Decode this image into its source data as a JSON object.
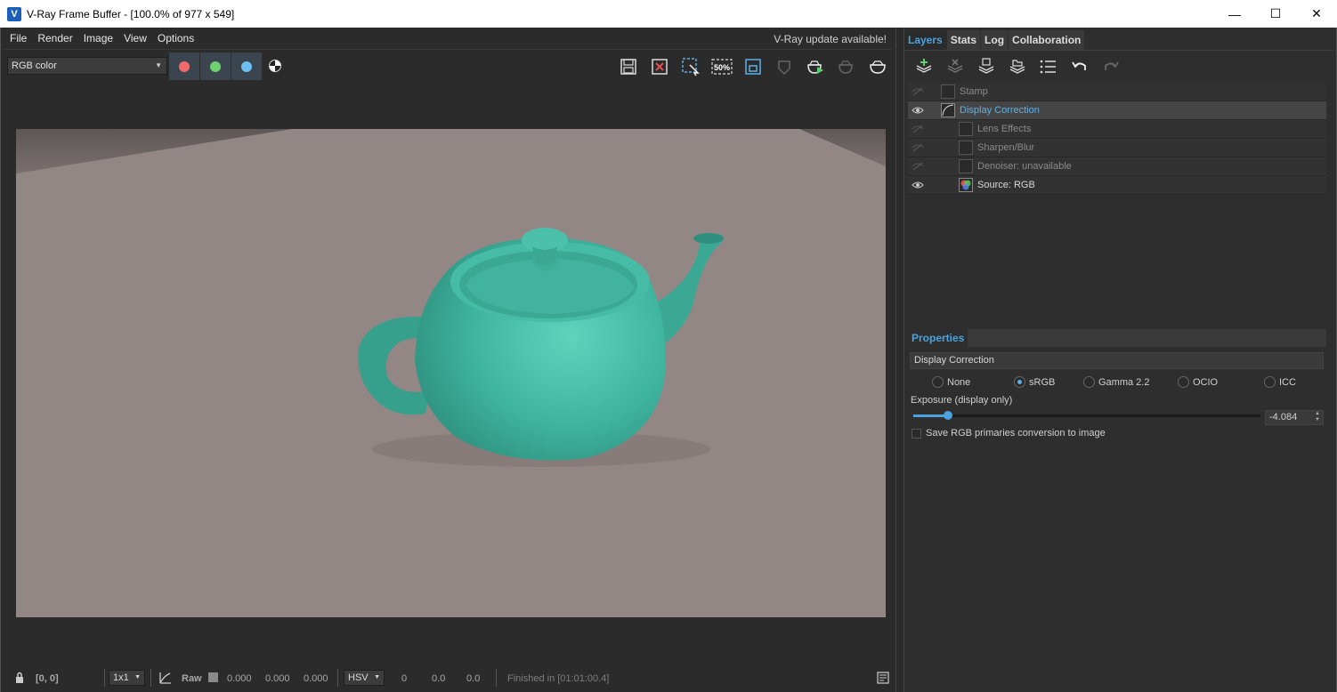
{
  "window": {
    "title": "V-Ray Frame Buffer - [100.0% of 977 x 549]",
    "app_icon_glyph": "V",
    "minimize_glyph": "—",
    "maximize_glyph": "☐",
    "close_glyph": "✕"
  },
  "menu": {
    "items": [
      "File",
      "Render",
      "Image",
      "View",
      "Options"
    ],
    "update_notice": "V-Ray update available!"
  },
  "toolbar": {
    "channel": "RGB color",
    "channel_buttons": [
      {
        "name": "red-channel",
        "color": "#ef6b6b"
      },
      {
        "name": "green-channel",
        "color": "#6ed06e"
      },
      {
        "name": "blue-channel",
        "color": "#6bc0ef"
      }
    ],
    "tool_icons": [
      "save-icon",
      "clear-image-icon",
      "region-render-icon",
      "track-mouse-icon",
      "render-region-icon",
      "lock-icon",
      "interactive-render-icon",
      "stop-render-icon",
      "render-icon"
    ],
    "track_label": "50%"
  },
  "status": {
    "coords": "[0, 0]",
    "sampling": "1x1",
    "raw_label": "Raw",
    "raw_values": [
      "0.000",
      "0.000",
      "0.000"
    ],
    "color_mode": "HSV",
    "hsv_values": [
      "0",
      "0.0",
      "0.0"
    ],
    "render_status": "Finished in [01:01:00.4]"
  },
  "right_panel": {
    "tabs": [
      "Layers",
      "Stats",
      "Log",
      "Collaboration"
    ],
    "active_tab": "Layers",
    "layer_tools": [
      "add-layer-icon",
      "delete-layer-icon",
      "save-layers-icon",
      "load-layers-icon",
      "layer-list-icon",
      "undo-icon",
      "redo-icon"
    ],
    "layers": [
      {
        "name": "Stamp",
        "visible": false,
        "selected": false,
        "indent": 0
      },
      {
        "name": "Display Correction",
        "visible": true,
        "selected": true,
        "indent": 0
      },
      {
        "name": "Lens Effects",
        "visible": false,
        "selected": false,
        "indent": 1
      },
      {
        "name": "Sharpen/Blur",
        "visible": false,
        "selected": false,
        "indent": 1
      },
      {
        "name": "Denoiser: unavailable",
        "visible": false,
        "selected": false,
        "indent": 1
      },
      {
        "name": "Source: RGB",
        "visible": true,
        "selected": false,
        "indent": 1
      }
    ]
  },
  "properties": {
    "tab_label": "Properties",
    "title": "Display Correction",
    "options": [
      "None",
      "sRGB",
      "Gamma 2.2",
      "OCIO",
      "ICC"
    ],
    "selected_option": "sRGB",
    "exposure_label": "Exposure (display only)",
    "exposure_value": "-4.084",
    "exposure_slider_fraction": 0.1,
    "save_primaries_label": "Save RGB primaries conversion to image",
    "save_primaries_checked": false
  },
  "colors": {
    "accent": "#4aa3df",
    "teapot": "#3fb5a0",
    "floor": "#938786"
  }
}
